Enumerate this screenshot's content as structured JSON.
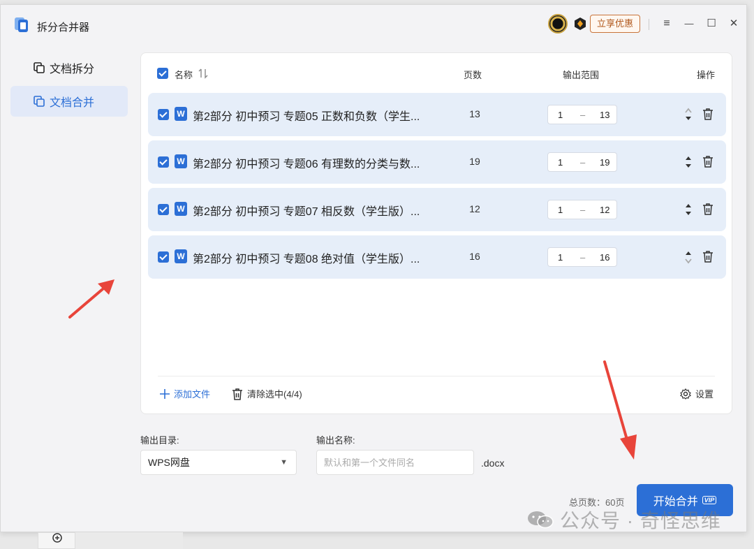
{
  "app": {
    "title": "拆分合并器",
    "promo_label": "立享优惠"
  },
  "window_controls": {
    "menu": "≡",
    "minimize": "—",
    "maximize": "☐",
    "close": "✕"
  },
  "sidebar": {
    "items": [
      {
        "label": "文档拆分",
        "active": false
      },
      {
        "label": "文档合并",
        "active": true
      }
    ]
  },
  "table": {
    "headers": {
      "name": "名称",
      "pages": "页数",
      "range": "输出范围",
      "action": "操作"
    },
    "rows": [
      {
        "name": "第2部分 初中预习 专题05 正数和负数（学生...",
        "pages": "13",
        "from": "1",
        "to": "13"
      },
      {
        "name": "第2部分 初中预习 专题06 有理数的分类与数...",
        "pages": "19",
        "from": "1",
        "to": "19"
      },
      {
        "name": "第2部分 初中预习 专题07 相反数（学生版）...",
        "pages": "12",
        "from": "1",
        "to": "12"
      },
      {
        "name": "第2部分 初中预习 专题08 绝对值（学生版）...",
        "pages": "16",
        "from": "1",
        "to": "16"
      }
    ],
    "range_dash": "–",
    "word_icon_letter": "W"
  },
  "footer": {
    "add_file": "添加文件",
    "clear_selected": "清除选中(4/4)",
    "settings": "设置"
  },
  "output": {
    "dir_label": "输出目录:",
    "dir_value": "WPS网盘",
    "name_label": "输出名称:",
    "name_placeholder": "默认和第一个文件同名",
    "extension": ".docx",
    "total_pages": "总页数：60页",
    "start_label": "开始合并",
    "vip_label": "VIP"
  },
  "watermark": {
    "text": "公众号 · 奇怪思维"
  },
  "colors": {
    "accent": "#2c6fd6",
    "row_bg": "#e6eef9",
    "promo": "#b0581c",
    "arrow": "#e8443a"
  }
}
